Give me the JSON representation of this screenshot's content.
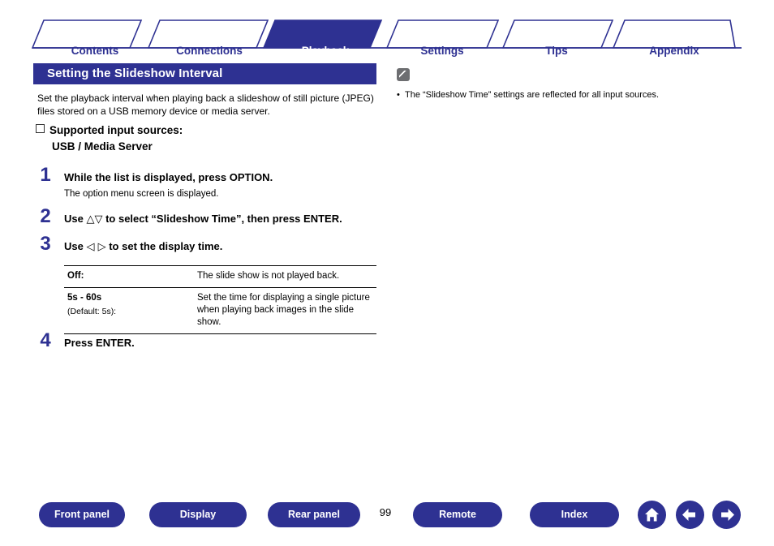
{
  "tabs": [
    {
      "label": "Contents",
      "active": false
    },
    {
      "label": "Connections",
      "active": false
    },
    {
      "label": "Playback",
      "active": true
    },
    {
      "label": "Settings",
      "active": false
    },
    {
      "label": "Tips",
      "active": false
    },
    {
      "label": "Appendix",
      "active": false
    }
  ],
  "heading": "Setting the Slideshow Interval",
  "intro": "Set the playback interval when playing back a slideshow of still picture (JPEG) files stored on a USB memory device or media server.",
  "supported": {
    "title": "Supported input sources:",
    "value": "USB / Media Server"
  },
  "steps": [
    {
      "num": "1",
      "title": "While the list is displayed, press OPTION.",
      "sub": "The option menu screen is displayed."
    },
    {
      "num": "2",
      "title_pre": "Use ",
      "title_sym": "△▽",
      "title_post": " to select “Slideshow Time”, then press ENTER.",
      "sub": ""
    },
    {
      "num": "3",
      "title_pre": "Use ",
      "title_sym": "◁ ▷",
      "title_post": " to set the display time.",
      "sub": ""
    },
    {
      "num": "4",
      "title": "Press ENTER.",
      "sub": ""
    }
  ],
  "options_table": [
    {
      "option": "Off:",
      "default": "",
      "description": "The slide show is not played back."
    },
    {
      "option": "5s - 60s",
      "default": "(Default: 5s):",
      "description": "Set the time for displaying a single picture when playing back images in the slide show."
    }
  ],
  "note": {
    "icon": "pencil-icon",
    "text": "The “Slideshow Time” settings are reflected for all input sources."
  },
  "bottom_nav": {
    "buttons": [
      {
        "label": "Front panel"
      },
      {
        "label": "Display"
      },
      {
        "label": "Rear panel"
      },
      {
        "label": "Remote"
      },
      {
        "label": "Index"
      }
    ],
    "page_number": "99",
    "icons": [
      {
        "name": "home-icon"
      },
      {
        "name": "arrow-left-icon"
      },
      {
        "name": "arrow-right-icon"
      }
    ]
  },
  "colors": {
    "brand": "#2e3192",
    "heading_text": "#ffffff"
  }
}
